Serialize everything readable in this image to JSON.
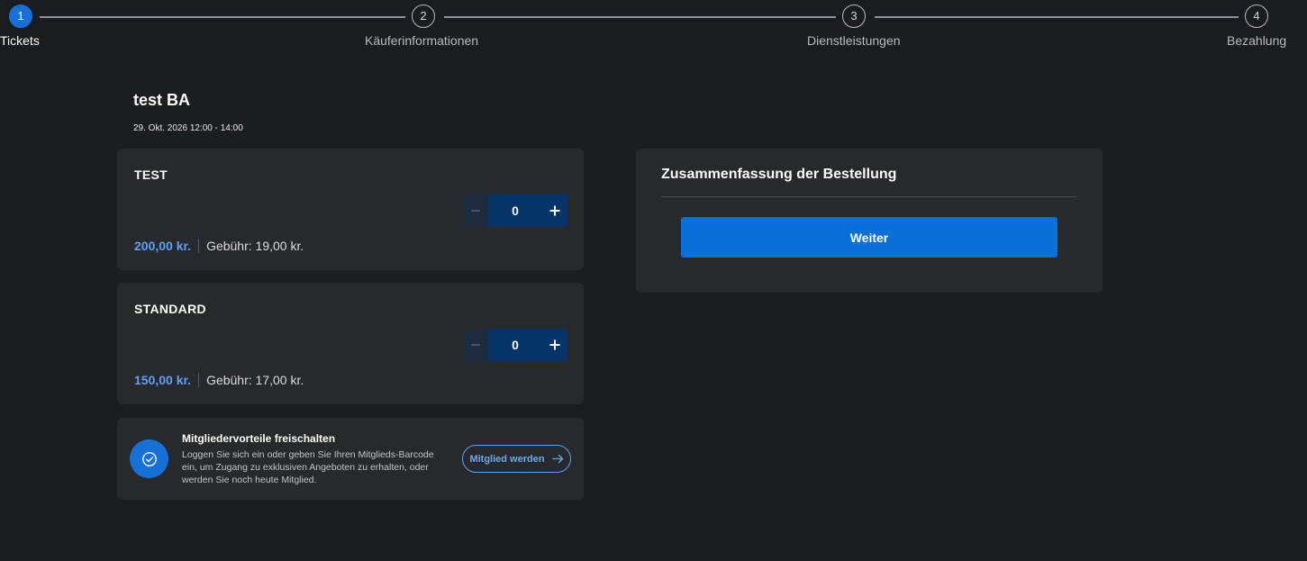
{
  "stepper": {
    "steps": [
      {
        "number": "1",
        "label": "Tickets"
      },
      {
        "number": "2",
        "label": "Käuferinformationen"
      },
      {
        "number": "3",
        "label": "Dienstleistungen"
      },
      {
        "number": "4",
        "label": "Bezahlung"
      }
    ],
    "active_step": 1
  },
  "event": {
    "title": "test BA",
    "date": "29. Okt. 2026 12:00 - 14:00"
  },
  "tickets": [
    {
      "name": "TEST",
      "quantity": "0",
      "price": "200,00 kr.",
      "fee": "Gebühr: 19,00 kr.",
      "minus_icon": "minus-icon",
      "plus_icon": "plus-icon"
    },
    {
      "name": "STANDARD",
      "quantity": "0",
      "price": "150,00 kr.",
      "fee": "Gebühr: 17,00 kr.",
      "minus_icon": "minus-icon",
      "plus_icon": "plus-icon"
    }
  ],
  "membership": {
    "icon": "check-circle-icon",
    "title": "Mitgliedervorteile freischalten",
    "text": "Loggen Sie sich ein oder geben Sie Ihren Mitglieds-Barcode ein, um Zugang zu exklusiven Angeboten zu erhalten, oder werden Sie noch heute Mitglied.",
    "button_label": "Mitglied werden",
    "button_icon": "arrow-right-icon"
  },
  "summary": {
    "title": "Zusammenfassung der Bestellung",
    "button_label": "Weiter"
  },
  "colors": {
    "accent": "#1670d6",
    "price": "#5ea1f2",
    "background": "#1c1d20",
    "card": "#28292c"
  }
}
